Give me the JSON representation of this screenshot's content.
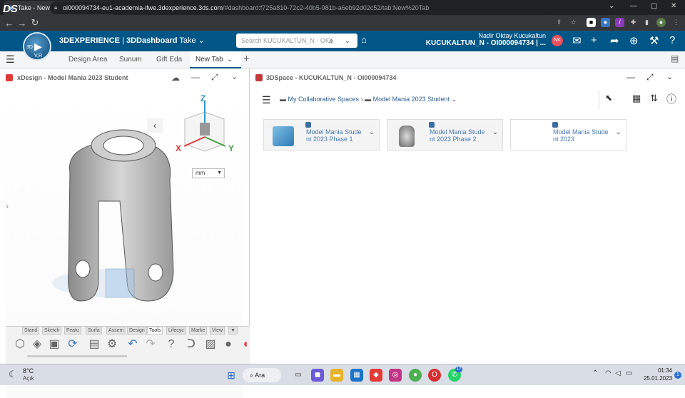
{
  "browser": {
    "tab_title": "Take - New Tab",
    "tab_close": "✕",
    "new_tab": "+",
    "url_host": "oi000094734-eu1-academia-ifwe.3dexperience.3ds.com",
    "url_path": "/#dashboard:f725a810-72c2-40b5-981b-a6eb92d02c52/tab:New%20Tab"
  },
  "app": {
    "brand": "3DEXPERIENCE",
    "separator": " | ",
    "app_name": "3DDashboard",
    "dashboard": "Take",
    "search_placeholder": "Search KUCUKALTUN_N - OI0(",
    "user_name": "Nadir Oktay Kucukaltun",
    "collab_space": "KUCUKALTUN_N - OI000094734 | ...",
    "avatar_initials": "NK",
    "compass_label_3d": "3D",
    "compass_label_v": "V,R"
  },
  "dashboard_tabs": [
    "Design Area",
    "Sunum",
    "Gift Eda",
    "New Tab"
  ],
  "left_widget": {
    "title": "xDesign - Model Mania 2023 Student",
    "unit": "mm",
    "axis_z": "Z",
    "axis_x": "X",
    "axis_y": "Y",
    "tool_tabs": [
      "Stand",
      "Sketch",
      "Featu",
      "Surfa",
      "Assem",
      "Design",
      "Tools",
      "Lifecyc",
      "Marke",
      "View"
    ],
    "active_tool_tab": "Tools"
  },
  "right_widget": {
    "title": "3DSpace - KUCUKALTUN_N - OI000094734",
    "breadcrumb_root": "My Collaborative Spaces",
    "breadcrumb_folder": "Model Mania 2023 Student",
    "cards": [
      {
        "line1": "Model Mania Stude",
        "line2": "nt 2023 Phase 1",
        "thumb": "cube"
      },
      {
        "line1": "Model Mania Stude",
        "line2": "nt 2023 Phase 2",
        "thumb": "part"
      },
      {
        "line1": "Model Mania Stude",
        "line2": "nt 2023",
        "thumb": "none"
      }
    ]
  },
  "taskbar": {
    "weather_temp": "8°C",
    "weather_desc": "Açık",
    "search": "Ara",
    "time": "01:34",
    "date": "25.01.2023",
    "notif_count": "1",
    "whatsapp_badge": "17"
  },
  "colors": {
    "brand_blue": "#005686",
    "link_blue": "#4779b3",
    "axis_z": "#3399cc",
    "axis_x": "#e03a3a",
    "axis_y": "#43a047"
  }
}
